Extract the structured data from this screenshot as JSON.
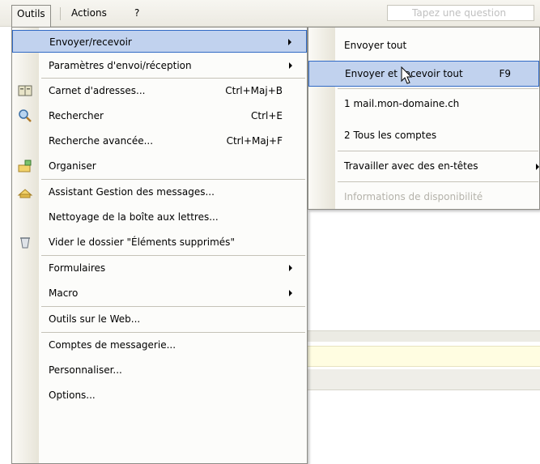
{
  "menubar": {
    "outils": "Outils",
    "actions": "Actions",
    "help": "?",
    "question_placeholder": "Tapez une question"
  },
  "menu": {
    "items": [
      {
        "label": "Envoyer/recevoir",
        "accel": "",
        "submenu": true,
        "icon": ""
      },
      {
        "label": "Paramètres d'envoi/réception",
        "accel": "",
        "submenu": true,
        "icon": ""
      },
      {
        "label": "Carnet d'adresses...",
        "accel": "Ctrl+Maj+B",
        "submenu": false,
        "icon": "address-book-icon"
      },
      {
        "label": "Rechercher",
        "accel": "Ctrl+E",
        "submenu": false,
        "icon": "search-icon"
      },
      {
        "label": "Recherche avancée...",
        "accel": "Ctrl+Maj+F",
        "submenu": false,
        "icon": ""
      },
      {
        "label": "Organiser",
        "accel": "",
        "submenu": false,
        "icon": "organize-icon"
      },
      {
        "label": "Assistant Gestion des messages...",
        "accel": "",
        "submenu": false,
        "icon": "rules-wizard-icon"
      },
      {
        "label": "Nettoyage de la boîte aux lettres...",
        "accel": "",
        "submenu": false,
        "icon": ""
      },
      {
        "label": "Vider le dossier \"Éléments supprimés\"",
        "accel": "",
        "submenu": false,
        "icon": "empty-trash-icon"
      },
      {
        "label": "Formulaires",
        "accel": "",
        "submenu": true,
        "icon": ""
      },
      {
        "label": "Macro",
        "accel": "",
        "submenu": true,
        "icon": ""
      },
      {
        "label": "Outils sur le Web...",
        "accel": "",
        "submenu": false,
        "icon": ""
      },
      {
        "label": "Comptes de messagerie...",
        "accel": "",
        "submenu": false,
        "icon": ""
      },
      {
        "label": "Personnaliser...",
        "accel": "",
        "submenu": false,
        "icon": ""
      },
      {
        "label": "Options...",
        "accel": "",
        "submenu": false,
        "icon": ""
      }
    ]
  },
  "submenu": {
    "items": [
      {
        "label": "Envoyer tout",
        "accel": ""
      },
      {
        "label": "Envoyer et recevoir tout",
        "accel": "F9"
      },
      {
        "label": "1 mail.mon-domaine.ch",
        "accel": ""
      },
      {
        "label": "2 Tous les comptes",
        "accel": ""
      },
      {
        "label": "Travailler avec des en-têtes",
        "accel": ""
      },
      {
        "label": "Informations de disponibilité",
        "accel": ""
      }
    ]
  },
  "colors": {
    "highlight_bg": "#c1d2ee",
    "highlight_border": "#316ac5",
    "disabled_text": "#b4b2aa"
  }
}
